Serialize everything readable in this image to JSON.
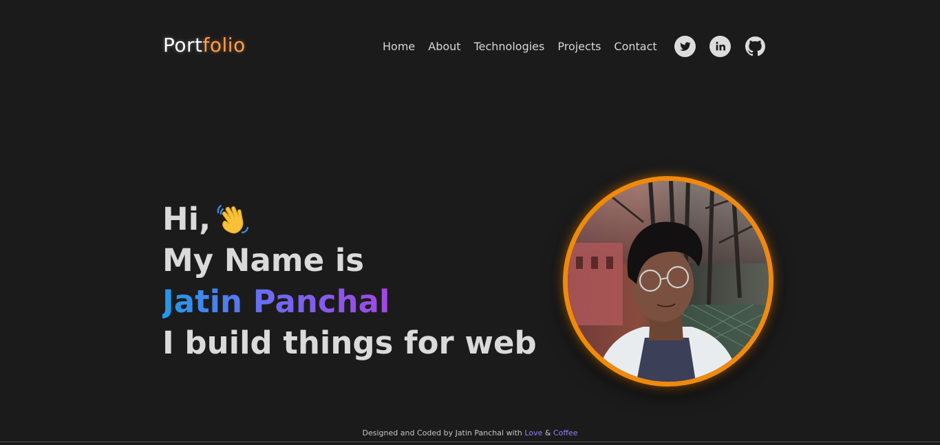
{
  "header": {
    "logo_part1": "Port",
    "logo_part2": "folio",
    "nav": [
      "Home",
      "About",
      "Technologies",
      "Projects",
      "Contact"
    ],
    "social_icons": [
      "twitter-icon",
      "linkedin-icon",
      "github-icon"
    ]
  },
  "hero": {
    "greeting": "Hi,",
    "greeting_icon": "waving-hand-icon",
    "line2": "My Name is",
    "name": "Jatin Panchal",
    "line4": "I build things for web"
  },
  "footer": {
    "text": "Designed and Coded by Jatin Panchal with ",
    "love": "Love",
    "amp": " & ",
    "coffee": "Coffee"
  },
  "colors": {
    "background": "#1b1b1c",
    "accent_orange": "#f08a0c",
    "gradient_start": "#1f9be9",
    "gradient_end": "#a347e2"
  }
}
